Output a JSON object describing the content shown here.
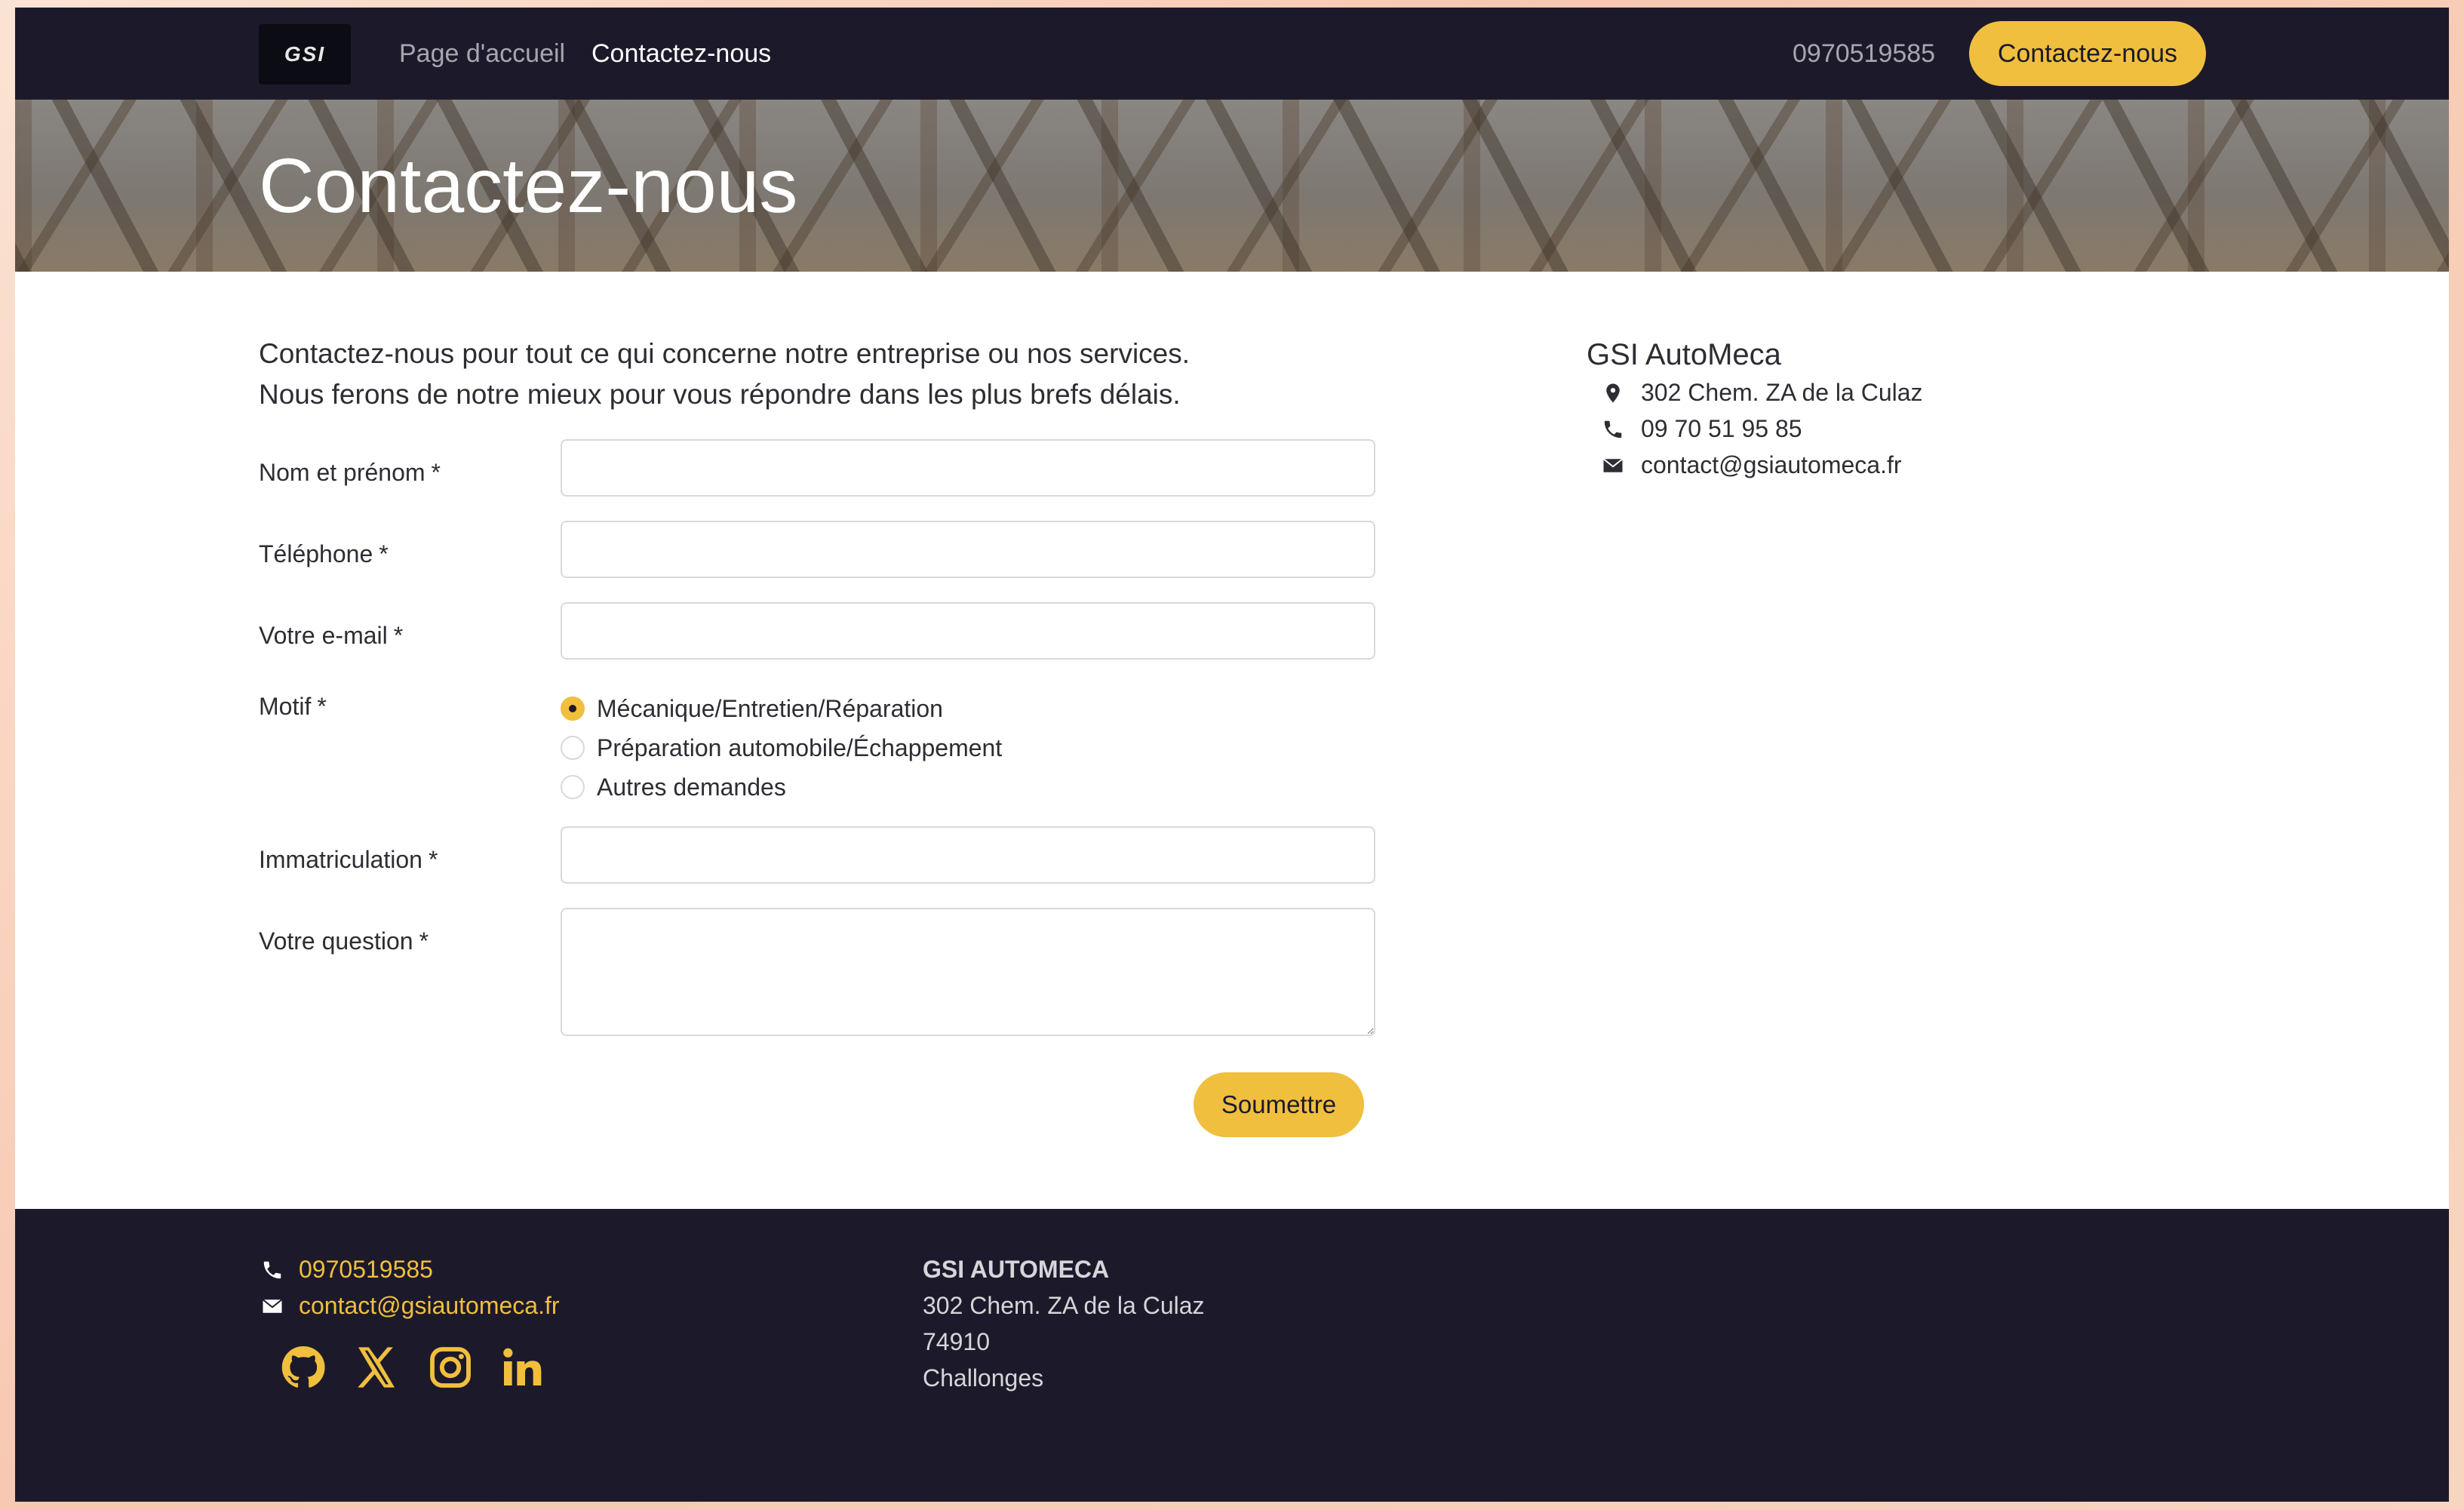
{
  "navbar": {
    "logo_text": "GSI",
    "links": [
      {
        "label": "Page d'accueil"
      },
      {
        "label": "Contactez-nous"
      }
    ],
    "phone": "0970519585",
    "cta_label": "Contactez-nous"
  },
  "hero": {
    "title": "Contactez-nous"
  },
  "form": {
    "intro_line1": "Contactez-nous pour tout ce qui concerne notre entreprise ou nos services.",
    "intro_line2": "Nous ferons de notre mieux pour vous répondre dans les plus brefs délais.",
    "required_mark": "*",
    "fields": {
      "name_label": "Nom et prénom",
      "phone_label": "Téléphone",
      "email_label": "Votre e-mail",
      "motif_label": "Motif",
      "plate_label": "Immatriculation",
      "question_label": "Votre question"
    },
    "motif_options": [
      {
        "label": "Mécanique/Entretien/Réparation",
        "checked": true
      },
      {
        "label": "Préparation automobile/Échappement",
        "checked": false
      },
      {
        "label": "Autres demandes",
        "checked": false
      }
    ],
    "submit_label": "Soumettre"
  },
  "company": {
    "name": "GSI AutoMeca",
    "address": "302 Chem. ZA de la Culaz",
    "phone": "09 70 51 95 85",
    "email": "contact@gsiautomeca.fr"
  },
  "footer": {
    "phone": "0970519585",
    "email": "contact@gsiautomeca.fr",
    "social_icons": [
      "github-icon",
      "x-twitter-icon",
      "instagram-icon",
      "linkedin-icon"
    ],
    "company_name": "GSI AUTOMECA",
    "address_line1": "302 Chem. ZA de la Culaz",
    "postal_code": "74910",
    "city": "Challonges"
  },
  "colors": {
    "nav_bg": "#1c1a2a",
    "accent": "#f0bf3e",
    "text": "#2d2d33",
    "border": "#d9d9dd"
  }
}
